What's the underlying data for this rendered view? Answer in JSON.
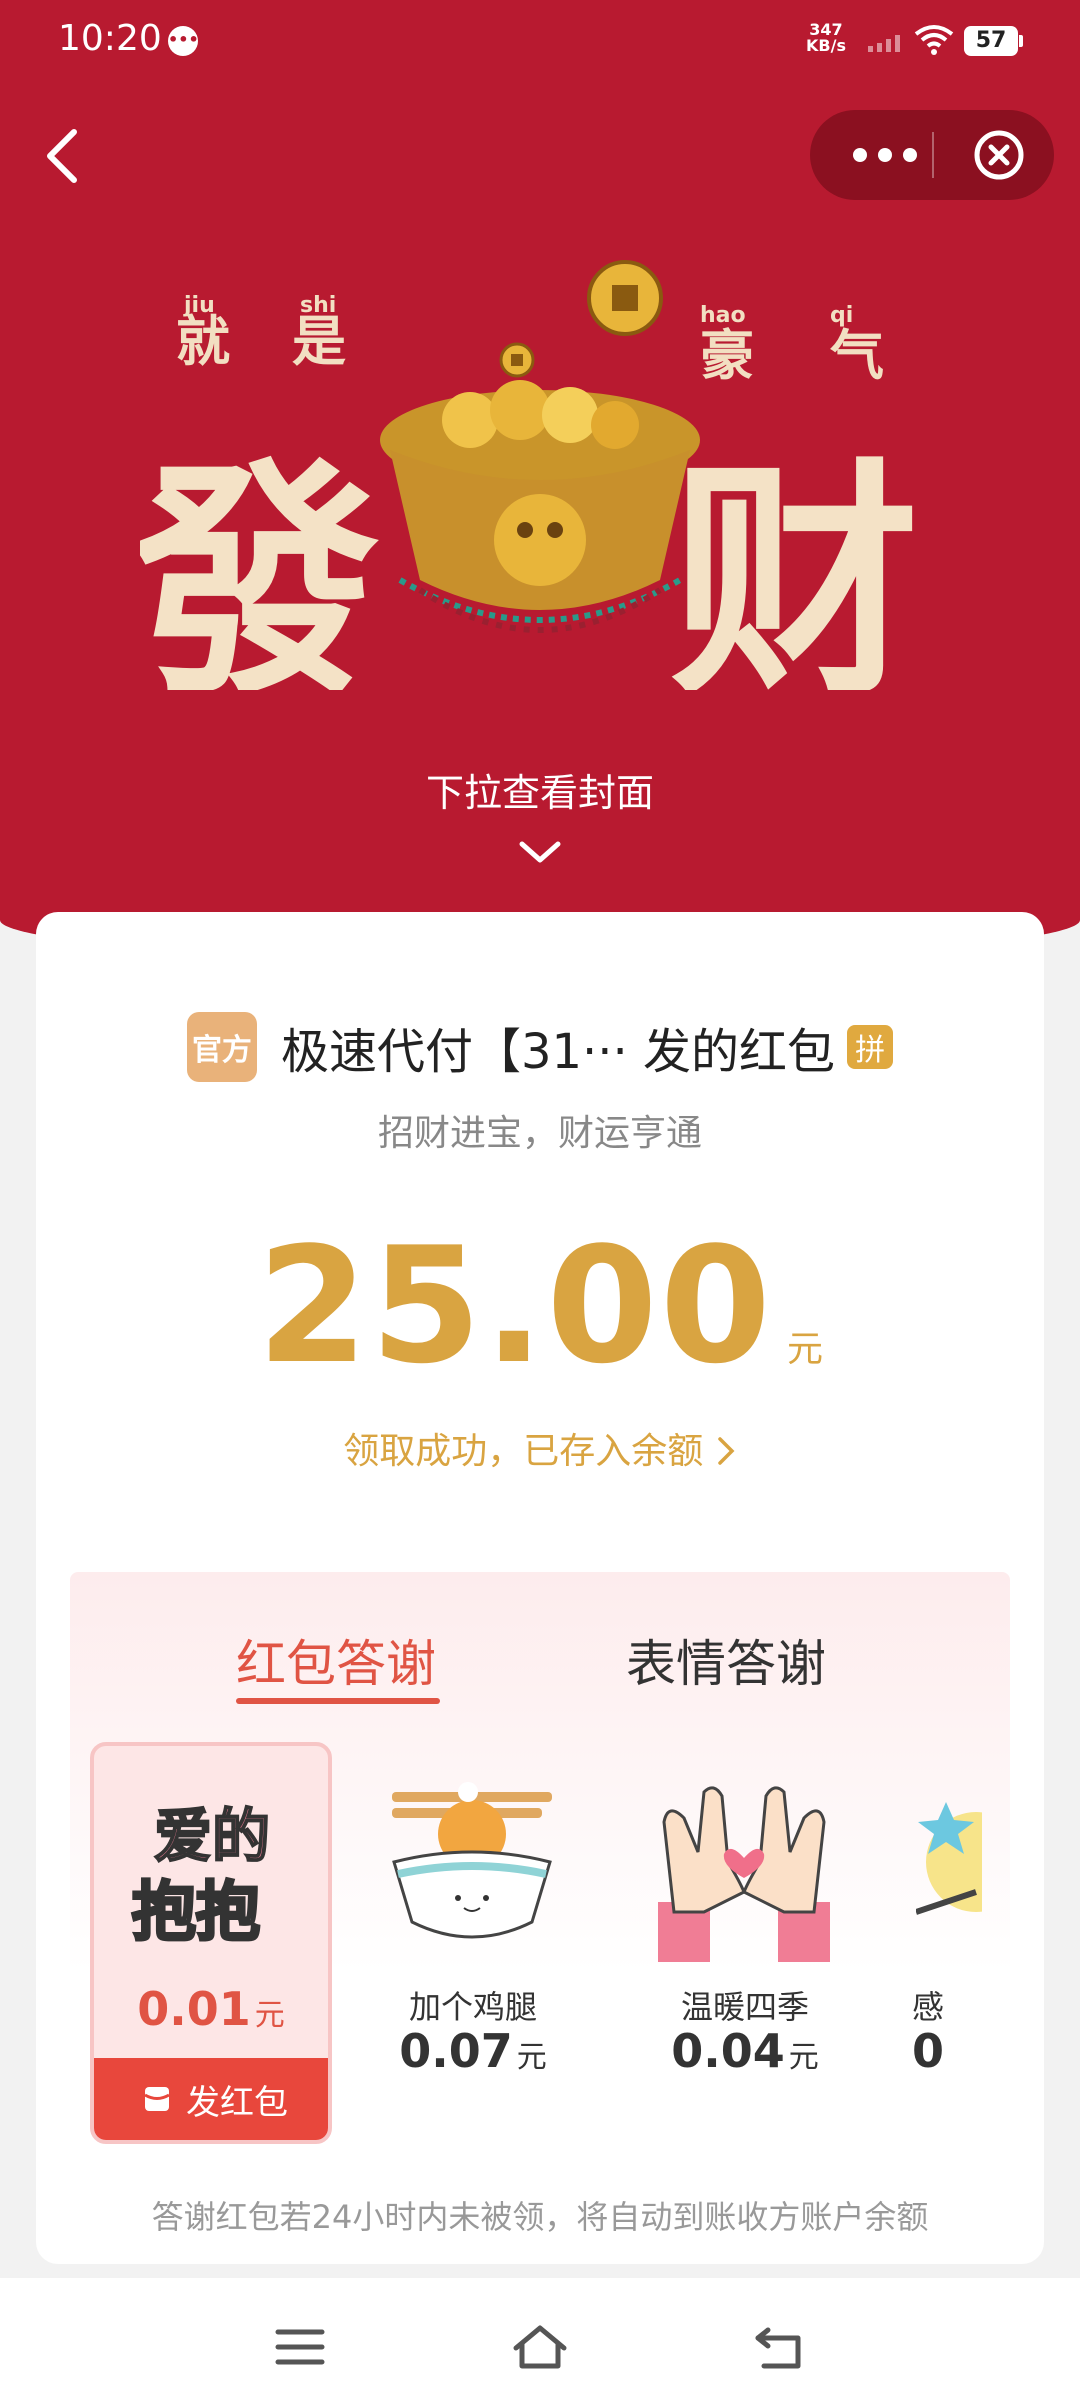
{
  "status_bar": {
    "time": "10:20",
    "net_speed_value": "347",
    "net_speed_unit": "KB/s",
    "battery": "57"
  },
  "cover": {
    "pull_hint": "下拉查看封面",
    "art_text": {
      "pinyin_left_1": "jiu",
      "pinyin_left_2": "shi",
      "pinyin_right_1": "hao",
      "pinyin_right_2": "qi",
      "small_left_1": "就",
      "small_left_2": "是",
      "small_right_1": "豪",
      "small_right_2": "气",
      "big_left": "發",
      "big_right": "财"
    }
  },
  "envelope": {
    "avatar_text": "官方",
    "sender": "极速代付【31··· 发的红包",
    "pin_badge": "拼",
    "blessing": "招财进宝，财运亨通",
    "amount": "25.00",
    "unit": "元",
    "received_link": "领取成功，已存入余额"
  },
  "thanks": {
    "tabs": [
      {
        "label": "红包答谢",
        "active": true
      },
      {
        "label": "表情答谢",
        "active": false
      }
    ],
    "gifts": [
      {
        "name": "",
        "image_text_1": "爱的",
        "image_text_2": "抱抱",
        "price": "0.01",
        "unit": "元",
        "selected": true
      },
      {
        "name": "加个鸡腿",
        "price": "0.07",
        "unit": "元"
      },
      {
        "name": "温暖四季",
        "price": "0.04",
        "unit": "元"
      },
      {
        "name": "感",
        "price": "0",
        "unit": ""
      }
    ],
    "send_button": "发红包",
    "footnote": "答谢红包若24小时内未被领，将自动到账收方账户余额"
  },
  "colors": {
    "hero_red": "#b81a30",
    "gold": "#d9a441",
    "accent_red": "#e05444"
  }
}
